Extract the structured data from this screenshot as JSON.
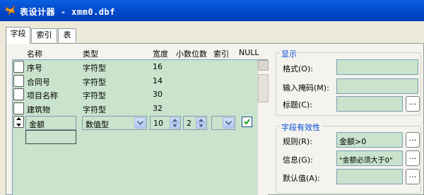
{
  "window": {
    "title": "表设计器 - xmm0.dbf",
    "app_icon": "fox-icon"
  },
  "tabs": [
    {
      "label": "字段",
      "active": true
    },
    {
      "label": "索引",
      "active": false
    },
    {
      "label": "表",
      "active": false
    }
  ],
  "columns": {
    "name": "名称",
    "type": "类型",
    "width": "宽度",
    "decimal": "小数位数",
    "index": "索引",
    "null": "NULL"
  },
  "fields": [
    {
      "name": "序号",
      "type": "字符型",
      "width": "16"
    },
    {
      "name": "合同号",
      "type": "字符型",
      "width": "14"
    },
    {
      "name": "项目名称",
      "type": "字符型",
      "width": "30"
    },
    {
      "name": "建筑物",
      "type": "字符型",
      "width": "32"
    }
  ],
  "current_field": {
    "name": "金额",
    "type": "数值型",
    "width": "10",
    "decimal": "2",
    "index": "",
    "null_checked": true,
    "row_icon": "move-updown-icon"
  },
  "display_group": {
    "legend": "显示",
    "format_label": "格式(O):",
    "mask_label": "输入掩码(M):",
    "caption_label": "标题(C):",
    "format_value": "",
    "mask_value": "",
    "caption_value": "",
    "builder_button": "..."
  },
  "validation_group": {
    "legend": "字段有效性",
    "rule_label": "规则(R):",
    "message_label": "信息(G):",
    "default_label": "默认值(A):",
    "rule_value": "金额>0",
    "message_value": "\"金额必须大于0\"",
    "default_value": "",
    "builder_button": "..."
  },
  "colors": {
    "title_bar": "#0046c8",
    "grid_bg": "#c9e3cc",
    "legend_text": "#0046d5"
  }
}
